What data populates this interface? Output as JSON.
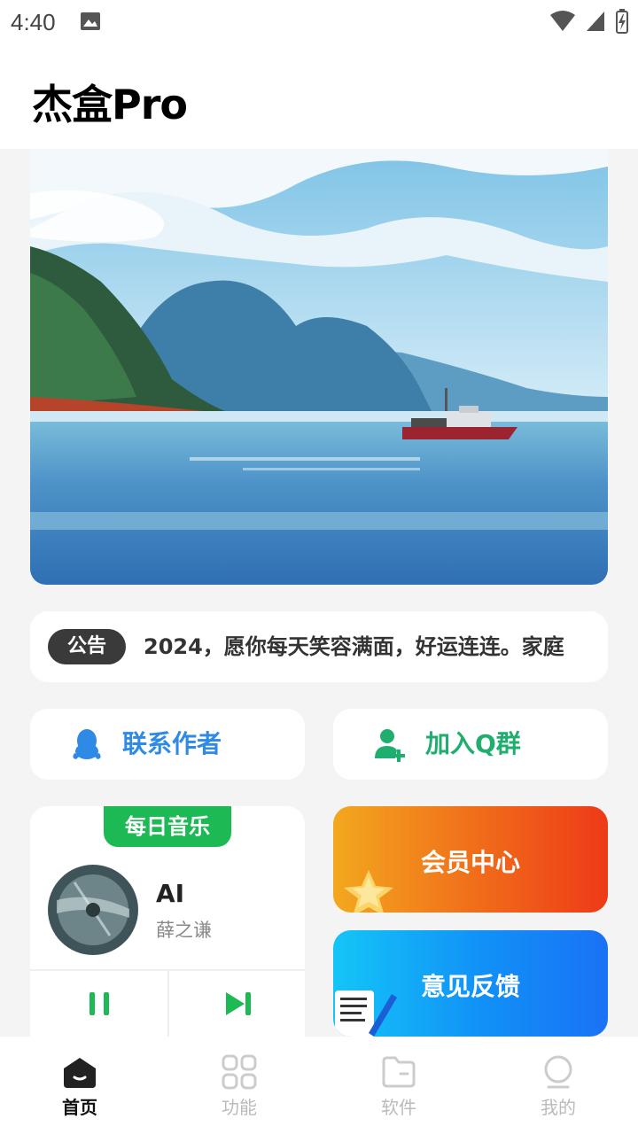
{
  "status_bar": {
    "time": "4:40"
  },
  "header": {
    "title": "杰盒Pro"
  },
  "notice": {
    "tag": "公告",
    "text": "2024，愿你每天笑容满面，好运连连。家庭"
  },
  "actions": {
    "contact": "联系作者",
    "join": "加入Q群"
  },
  "music": {
    "badge": "每日音乐",
    "song": "AI",
    "artist": "薛之谦"
  },
  "cards": {
    "member": "会员中心",
    "feedback": "意见反馈"
  },
  "nav": [
    {
      "label": "首页",
      "icon": "home-icon",
      "active": true
    },
    {
      "label": "功能",
      "icon": "grid-icon",
      "active": false
    },
    {
      "label": "软件",
      "icon": "folder-icon",
      "active": false
    },
    {
      "label": "我的",
      "icon": "profile-icon",
      "active": false
    }
  ],
  "colors": {
    "accent_green": "#1db954",
    "contact_blue": "#2f8ae6",
    "join_green": "#1fae6e"
  }
}
